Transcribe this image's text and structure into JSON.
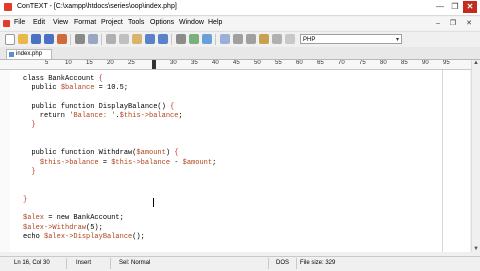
{
  "window": {
    "title": "ConTEXT - [C:\\xampp\\htdocs\\series\\oop\\index.php]",
    "min_glyph": "—",
    "max_glyph": "❐",
    "close_glyph": "✕"
  },
  "menu": {
    "items": [
      "File",
      "Edit",
      "View",
      "Format",
      "Project",
      "Tools",
      "Options",
      "Window",
      "Help"
    ],
    "controls": "– ❐ ✕"
  },
  "toolbar": {
    "highlighter": "PHP",
    "highlighter_arrow": "▾"
  },
  "tabs": [
    {
      "label": "index.php",
      "active": true
    }
  ],
  "ruler": {
    "labels": [
      "5",
      "10",
      "15",
      "20",
      "25",
      "30",
      "35",
      "40",
      "45",
      "50",
      "55",
      "60",
      "65",
      "70",
      "75",
      "80",
      "85",
      "90",
      "95"
    ]
  },
  "code": {
    "lines": [
      "class BankAccount {",
      "  public $balance = 10.5;",
      "",
      "  public function DisplayBalance() {",
      "    return 'Balance: '.$this->balance;",
      "  }",
      "",
      "",
      "  public function Withdraw($amount) {",
      "    $this->balance = $this->balance - $amount;",
      "  }",
      "",
      "",
      "}",
      "",
      "$alex = new BankAccount;",
      "$alex->Withdraw(5);",
      "echo $alex->DisplayBalance();",
      "",
      "",
      "?>"
    ]
  },
  "status": {
    "position": "Ln 16, Col 30",
    "mode": "Insert",
    "selection": "Sel: Normal",
    "line_ending": "DOS",
    "file_size": "File size: 329"
  },
  "colors": {
    "accent_icon": "#e03b2b",
    "variable": "#b0451f",
    "brace": "#c23030",
    "close_button": "#c42b1c"
  }
}
